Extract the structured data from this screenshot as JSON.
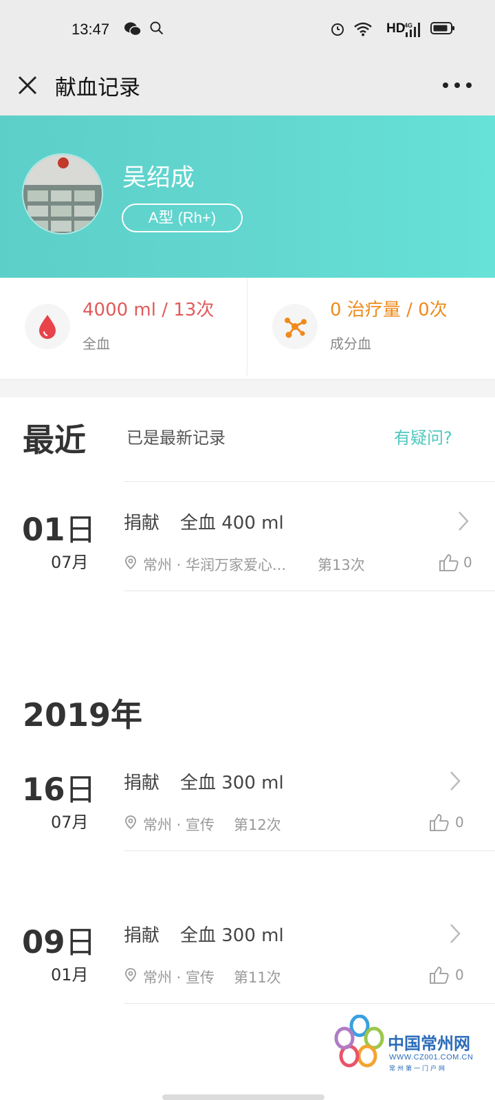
{
  "status_bar": {
    "time": "13:47",
    "network": "HD",
    "network_gen": "4G"
  },
  "header": {
    "title": "献血记录"
  },
  "profile": {
    "name": "吴绍成",
    "blood_type": "A型 (Rh+)"
  },
  "stats": {
    "whole": {
      "value": "4000 ml / 13次",
      "label": "全血",
      "color": "#e05a5a"
    },
    "component": {
      "value": "0 治疗量 / 0次",
      "label": "成分血",
      "color": "#ee8a1a"
    }
  },
  "recent": {
    "title": "最近",
    "status": "已是最新记录",
    "help": "有疑问?"
  },
  "records_recent": [
    {
      "day": "01",
      "day_unit": "日",
      "month": "07月",
      "type": "捐献",
      "detail": "全血 400 ml",
      "location": "常州 · 华润万家爱心...",
      "count": "第13次",
      "likes": "0"
    }
  ],
  "year_section": {
    "title": "2019年"
  },
  "records_2019": [
    {
      "day": "16",
      "day_unit": "日",
      "month": "07月",
      "type": "捐献",
      "detail": "全血 300 ml",
      "location": "常州 · 宣传",
      "count": "第12次",
      "likes": "0"
    },
    {
      "day": "09",
      "day_unit": "日",
      "month": "01月",
      "type": "捐献",
      "detail": "全血 300 ml",
      "location": "常州 · 宣传",
      "count": "第11次",
      "likes": "0"
    }
  ],
  "watermark": {
    "name": "中国常州网",
    "url": "WWW.CZ001.COM.CN",
    "sub": "常州第一门户网"
  },
  "theme": {
    "accent": "#4ec7c0",
    "header_band": "#62d6cf"
  }
}
